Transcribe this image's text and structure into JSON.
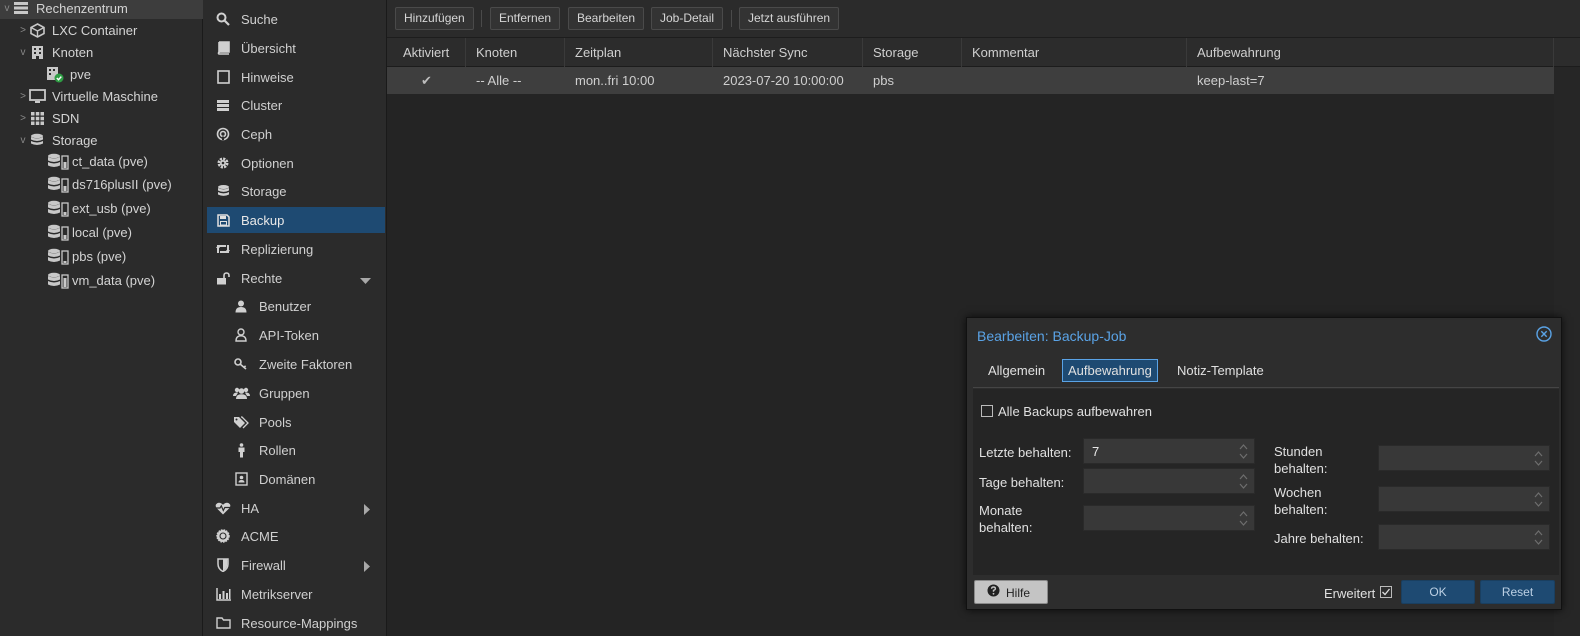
{
  "tree": {
    "items": [
      {
        "label": "Rechenzentrum",
        "toggle": "v",
        "icon": "server-rack-icon"
      },
      {
        "label": "LXC Container",
        "toggle": ">",
        "icon": "cube-icon"
      },
      {
        "label": "Knoten",
        "toggle": "v",
        "icon": "building-icon"
      },
      {
        "label": "pve",
        "toggle": "",
        "icon": "node-online-icon"
      },
      {
        "label": "Virtuelle Maschine",
        "toggle": ">",
        "icon": "monitor-icon"
      },
      {
        "label": "SDN",
        "toggle": ">",
        "icon": "grid-icon"
      },
      {
        "label": "Storage",
        "toggle": "v",
        "icon": "database-icon"
      },
      {
        "label": "ct_data (pve)",
        "toggle": "",
        "icon": "storage-icon"
      },
      {
        "label": "ds716plusII (pve)",
        "toggle": "",
        "icon": "storage-icon"
      },
      {
        "label": "ext_usb (pve)",
        "toggle": "",
        "icon": "storage-icon"
      },
      {
        "label": "local (pve)",
        "toggle": "",
        "icon": "storage-icon"
      },
      {
        "label": "pbs (pve)",
        "toggle": "",
        "icon": "storage-icon"
      },
      {
        "label": "vm_data (pve)",
        "toggle": "",
        "icon": "storage-icon"
      }
    ]
  },
  "nav": {
    "items": [
      {
        "label": "Suche",
        "icon": "search-icon"
      },
      {
        "label": "Übersicht",
        "icon": "book-icon"
      },
      {
        "label": "Hinweise",
        "icon": "note-icon"
      },
      {
        "label": "Cluster",
        "icon": "server-icon"
      },
      {
        "label": "Ceph",
        "icon": "ceph-icon"
      },
      {
        "label": "Optionen",
        "icon": "gear-icon"
      },
      {
        "label": "Storage",
        "icon": "database-icon"
      },
      {
        "label": "Backup",
        "icon": "floppy-icon"
      },
      {
        "label": "Replizierung",
        "icon": "retweet-icon"
      },
      {
        "label": "Rechte",
        "icon": "unlock-icon"
      },
      {
        "label": "Benutzer",
        "icon": "user-icon"
      },
      {
        "label": "API-Token",
        "icon": "user-outline-icon"
      },
      {
        "label": "Zweite Faktoren",
        "icon": "key-icon"
      },
      {
        "label": "Gruppen",
        "icon": "users-icon"
      },
      {
        "label": "Pools",
        "icon": "tags-icon"
      },
      {
        "label": "Rollen",
        "icon": "male-icon"
      },
      {
        "label": "Domänen",
        "icon": "id-card-icon"
      },
      {
        "label": "HA",
        "icon": "heartbeat-icon"
      },
      {
        "label": "ACME",
        "icon": "certificate-icon"
      },
      {
        "label": "Firewall",
        "icon": "shield-icon"
      },
      {
        "label": "Metrikserver",
        "icon": "bar-chart-icon"
      },
      {
        "label": "Resource-Mappings",
        "icon": "folder-icon"
      }
    ]
  },
  "toolbar": {
    "add": "Hinzufügen",
    "remove": "Entfernen",
    "edit": "Bearbeiten",
    "job_detail": "Job-Detail",
    "run_now": "Jetzt ausführen"
  },
  "grid": {
    "columns": [
      "Aktiviert",
      "Knoten",
      "Zeitplan",
      "Nächster Sync",
      "Storage",
      "Kommentar",
      "Aufbewahrung"
    ],
    "rows": [
      {
        "enabled": "✔",
        "node": "-- Alle --",
        "schedule": "mon..fri 10:00",
        "next_sync": "2023-07-20 10:00:00",
        "storage": "pbs",
        "comment": "",
        "retention": "keep-last=7"
      }
    ]
  },
  "dialog": {
    "title": "Bearbeiten: Backup-Job",
    "tabs": [
      "Allgemein",
      "Aufbewahrung",
      "Notiz-Template"
    ],
    "active_tab": "Aufbewahrung",
    "keep_all_label": "Alle Backups aufbewahren",
    "keep_last_label": "Letzte behalten:",
    "keep_last_value": "7",
    "keep_daily_label": "Tage behalten:",
    "keep_monthly_label_1": "Monate",
    "keep_monthly_label_2": "behalten:",
    "keep_hourly_label_1": "Stunden",
    "keep_hourly_label_2": "behalten:",
    "keep_weekly_label_1": "Wochen",
    "keep_weekly_label_2": "behalten:",
    "keep_yearly_label": "Jahre behalten:",
    "help": "Hilfe",
    "advanced": "Erweitert",
    "ok": "OK",
    "reset": "Reset"
  },
  "colors": {
    "accent": "#5aa3e6",
    "selected_nav": "#1e4a72",
    "status_ok": "#2e9e44"
  }
}
